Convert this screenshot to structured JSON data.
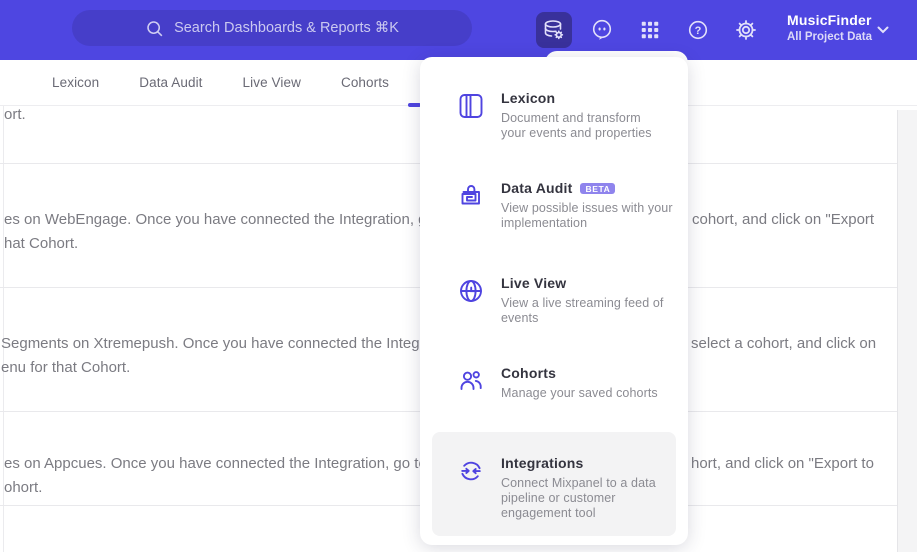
{
  "colors": {
    "accent": "#4f44e0",
    "header_bg": "#4e46e1",
    "header_active_bg": "#39319b",
    "search_bg": "#463ec9",
    "badge_bg": "#8f84ed",
    "highlight_bg": "#f3f3f4"
  },
  "header": {
    "search": {
      "placeholder": "Search Dashboards & Reports ⌘K",
      "icon": "search-icon"
    },
    "nav_icons": [
      "data-management-icon",
      "messages-icon",
      "apps-grid-icon",
      "help-icon",
      "settings-icon"
    ],
    "active_nav_icon": "data-management-icon",
    "project": {
      "name": "MusicFinder",
      "scope": "All Project Data",
      "chevron": "chevron-down-icon"
    }
  },
  "tabs": [
    {
      "label": "Lexicon"
    },
    {
      "label": "Data Audit"
    },
    {
      "label": "Live View"
    },
    {
      "label": "Cohorts"
    }
  ],
  "menu": {
    "items": [
      {
        "icon": "lexicon-book-icon",
        "title": "Lexicon",
        "description_lines": [
          "Document and transform",
          "your events and properties"
        ]
      },
      {
        "icon": "data-audit-lock-icon",
        "title": "Data Audit",
        "badge": "BETA",
        "description_lines": [
          "View possible issues with your",
          "implementation"
        ]
      },
      {
        "icon": "live-view-globe-icon",
        "title": "Live View",
        "description_lines": [
          "View a live streaming feed of",
          "events"
        ]
      },
      {
        "icon": "cohorts-users-icon",
        "title": "Cohorts",
        "description_lines": [
          "Manage your saved cohorts"
        ]
      },
      {
        "icon": "integrations-sync-icon",
        "title": "Integrations",
        "highlighted": true,
        "description_lines": [
          "Connect Mixpanel to a data",
          "pipeline or customer",
          "engagement tool"
        ]
      }
    ]
  },
  "content": {
    "rows": [
      {
        "line2_left": "ort."
      },
      {
        "line1_left": "es on WebEngage. Once you have connected the Integration, go to the",
        "line1_right": "cohort, and click on \"Export",
        "line2_left": "hat Cohort."
      },
      {
        "line1_left": "Segments on Xtremepush. Once you have connected the Integration,",
        "line1_right": "select a cohort, and click on",
        "line2_left": "enu for that Cohort."
      },
      {
        "line1_left": "es on Appcues. Once you have connected the Integration, go to the M",
        "line1_right": "hort, and click on \"Export to",
        "line2_left": "ohort."
      }
    ]
  }
}
